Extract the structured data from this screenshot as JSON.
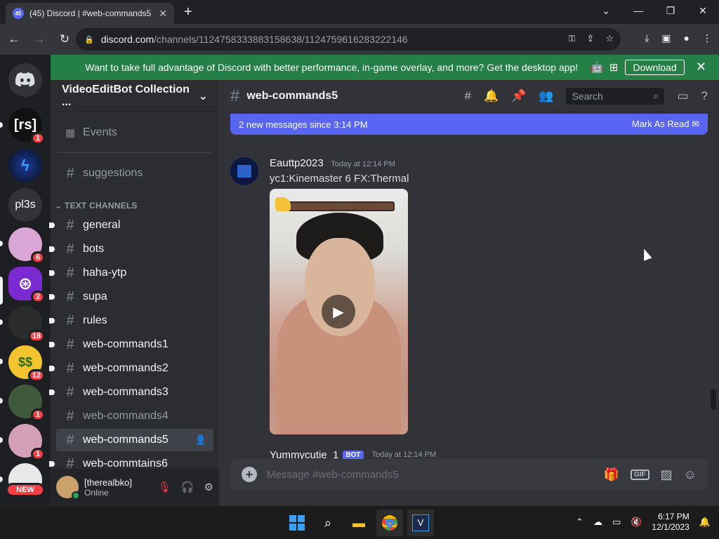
{
  "browser": {
    "tab_title": "(45) Discord | #web-commands5",
    "tab_badge": "45",
    "url_host": "discord.com",
    "url_path": "/channels/1124758333883158638/1124759616283222146",
    "window_controls": [
      "chevron-down-icon",
      "minimize-icon",
      "restore-icon",
      "close-icon"
    ]
  },
  "notice": {
    "text": "Want to take full advantage of Discord with better performance, in-game overlay, and more? Get the desktop app!",
    "download_label": "Download"
  },
  "guilds": [
    {
      "label": "[rs]",
      "badge": "1",
      "color": "#111111"
    },
    {
      "label": "",
      "badge": "",
      "color": "#0e1a3f"
    },
    {
      "label": "pl3s",
      "badge": "",
      "color": "#313338"
    },
    {
      "label": "",
      "badge": "6",
      "color": "#d9a6d6"
    },
    {
      "label": "",
      "badge": "2",
      "color": "#7b2ad1"
    },
    {
      "label": "",
      "badge": "18",
      "color": "#2b2b2b"
    },
    {
      "label": "",
      "badge": "12",
      "color": "#f4c430"
    },
    {
      "label": "",
      "badge": "1",
      "color": "#3f5a3a"
    },
    {
      "label": "",
      "badge": "1",
      "color": "#d3a0b8"
    },
    {
      "label": "",
      "badge": "",
      "color": "#e8e8e8"
    }
  ],
  "new_badge": "NEW",
  "sidebar": {
    "server_name": "VideoEditBot Collection ...",
    "top_items": [
      {
        "label": "Events",
        "icon": "calendar-icon"
      },
      {
        "label": "suggestions",
        "icon": "hash-icon"
      }
    ],
    "category": "TEXT CHANNELS",
    "channels": [
      {
        "label": "general",
        "unread": true
      },
      {
        "label": "bots",
        "unread": true
      },
      {
        "label": "haha-ytp",
        "unread": true
      },
      {
        "label": "supa",
        "unread": true
      },
      {
        "label": "rules",
        "unread": true
      },
      {
        "label": "web-commands1",
        "unread": true
      },
      {
        "label": "web-commands2",
        "unread": true
      },
      {
        "label": "web-commands3",
        "unread": true
      },
      {
        "label": "web-commands4",
        "unread": false
      },
      {
        "label": "web-commands5",
        "active": true
      },
      {
        "label": "web-commtains6",
        "unread": true
      }
    ]
  },
  "user": {
    "name": "[therealbko]",
    "status": "Online"
  },
  "channel": {
    "name": "web-commands5",
    "search_placeholder": "Search",
    "new_messages_text": "2 new messages since 3:14 PM",
    "mark_read_label": "Mark As Read"
  },
  "messages": [
    {
      "author": "Eauttp2023",
      "timestamp": "Today at 12:14 PM",
      "content": "yc1:Kinemaster 6 FX:Thermal"
    }
  ],
  "next_message": {
    "author": "Yummycutie_1",
    "tag": "BOT",
    "timestamp": "Today at 12:14 PM"
  },
  "composer": {
    "placeholder": "Message #web-commands5",
    "gif_label": "GIF"
  },
  "taskbar": {
    "time": "6:17 PM",
    "date": "12/1/2023"
  },
  "colors": {
    "blurple": "#5865f2",
    "green_banner": "#248046",
    "badge_red": "#f23f43"
  }
}
